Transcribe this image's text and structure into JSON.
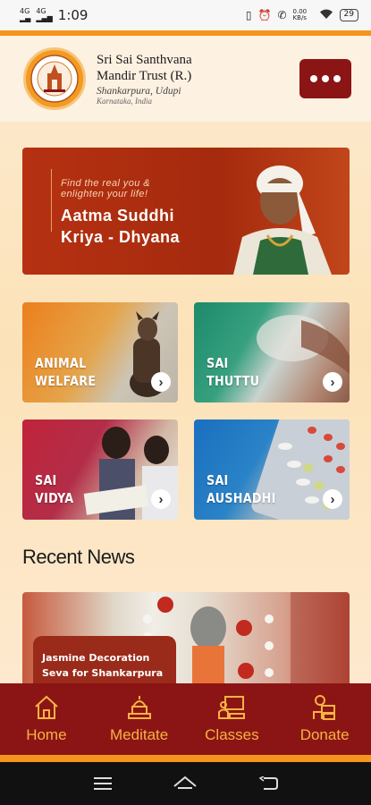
{
  "status_bar": {
    "time": "1:09",
    "signal_left": "4G",
    "signal_right": "4G",
    "net_speed": "0.00\nKB/s",
    "battery": "29"
  },
  "header": {
    "title_line1": "Sri Sai Santhvana",
    "title_line2": "Mandir Trust (R.)",
    "location": "Shankarpura, Udupi",
    "state": "Karnataka, India"
  },
  "banner": {
    "tagline_line1": "Find the real you &",
    "tagline_line2": "enlighten your life!",
    "title_line1": "Aatma Suddhi",
    "title_line2": "Kriya - Dhyana"
  },
  "tiles": [
    {
      "line1": "Animal",
      "line2": "Welfare"
    },
    {
      "line1": "Sai",
      "line2": "Thuttu"
    },
    {
      "line1": "Sai",
      "line2": "Vidya"
    },
    {
      "line1": "Sai",
      "line2": "Aushadhi"
    }
  ],
  "recent_news": {
    "heading": "Recent News",
    "card_caption_line1": "Jasmine Decoration",
    "card_caption_line2": "Seva for Shankarpura"
  },
  "bottom_nav": [
    {
      "label": "Home",
      "icon": "home-icon"
    },
    {
      "label": "Meditate",
      "icon": "temple-icon"
    },
    {
      "label": "Classes",
      "icon": "classes-icon"
    },
    {
      "label": "Donate",
      "icon": "donate-icon"
    }
  ],
  "colors": {
    "maroon": "#8b1515",
    "orange_accent": "#f5951d",
    "nav_text": "#f6b342"
  }
}
